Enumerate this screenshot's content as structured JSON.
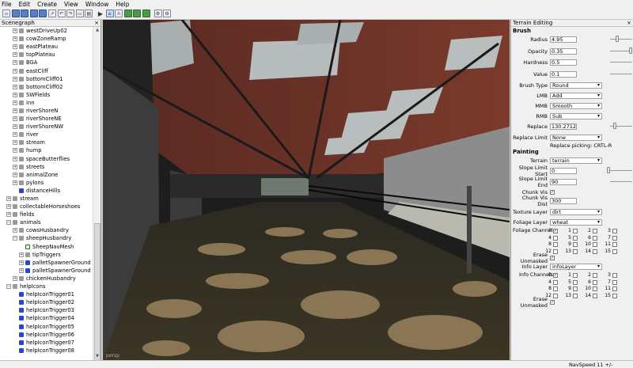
{
  "menu": [
    "File",
    "Edit",
    "Create",
    "View",
    "Window",
    "Help"
  ],
  "toolbar_icons": [
    "new-file",
    "open-file",
    "save-file",
    "save-all",
    "import",
    "export",
    "undo",
    "redo",
    "copy",
    "paste",
    "play",
    "select-tool",
    "terrain-tool",
    "foliage-tool",
    "grass-tool",
    "paint-tool",
    "snap-tool",
    "settings-tool"
  ],
  "scenegraph": {
    "title": "Scenegraph",
    "close": "×",
    "rows": [
      {
        "label": "westDriveUp02",
        "indent": 1,
        "icon": "grp",
        "exp": "+"
      },
      {
        "label": "cowZoneRamp",
        "indent": 1,
        "icon": "grp",
        "exp": "+"
      },
      {
        "label": "eastPlateau",
        "indent": 1,
        "icon": "grp",
        "exp": "+"
      },
      {
        "label": "topPlateau",
        "indent": 1,
        "icon": "grp",
        "exp": "+"
      },
      {
        "label": "BGA",
        "indent": 1,
        "icon": "grp",
        "exp": "+"
      },
      {
        "label": "eastCliff",
        "indent": 1,
        "icon": "grp",
        "exp": "+"
      },
      {
        "label": "bottomCliff01",
        "indent": 1,
        "icon": "grp",
        "exp": "+"
      },
      {
        "label": "bottomCliff02",
        "indent": 1,
        "icon": "grp",
        "exp": "+"
      },
      {
        "label": "SWFields",
        "indent": 1,
        "icon": "grp",
        "exp": "+"
      },
      {
        "label": "inn",
        "indent": 1,
        "icon": "grp",
        "exp": "+"
      },
      {
        "label": "riverShoreN",
        "indent": 1,
        "icon": "grp",
        "exp": "+"
      },
      {
        "label": "riverShoreNE",
        "indent": 1,
        "icon": "grp",
        "exp": "+"
      },
      {
        "label": "riverShoreNW",
        "indent": 1,
        "icon": "grp",
        "exp": "+"
      },
      {
        "label": "river",
        "indent": 1,
        "icon": "grp",
        "exp": "+"
      },
      {
        "label": "stream",
        "indent": 1,
        "icon": "grp",
        "exp": "+"
      },
      {
        "label": "hump",
        "indent": 1,
        "icon": "grp",
        "exp": "+"
      },
      {
        "label": "spaceButterflies",
        "indent": 1,
        "icon": "grp",
        "exp": "+"
      },
      {
        "label": "streets",
        "indent": 1,
        "icon": "grp",
        "exp": "+"
      },
      {
        "label": "animalZone",
        "indent": 1,
        "icon": "grp",
        "exp": "+"
      },
      {
        "label": "pylons",
        "indent": 1,
        "icon": "grp",
        "exp": "+"
      },
      {
        "label": "distanceHills",
        "indent": 1,
        "icon": "blue",
        "exp": ""
      },
      {
        "label": "stream",
        "indent": 0,
        "icon": "grp",
        "exp": "+"
      },
      {
        "label": "collectableHorseshoes",
        "indent": 0,
        "icon": "grp",
        "exp": "+"
      },
      {
        "label": "fields",
        "indent": 0,
        "icon": "grp",
        "exp": "+"
      },
      {
        "label": "animals",
        "indent": 0,
        "icon": "grp",
        "exp": "−"
      },
      {
        "label": "cowsHusbandry",
        "indent": 1,
        "icon": "grp",
        "exp": "+"
      },
      {
        "label": "sheepHusbandry",
        "indent": 1,
        "icon": "grp",
        "exp": "−"
      },
      {
        "label": "SheepNavMesh",
        "indent": 2,
        "icon": "mesh",
        "exp": ""
      },
      {
        "label": "tipTriggers",
        "indent": 2,
        "icon": "grp",
        "exp": "+"
      },
      {
        "label": "palletSpawnerGround",
        "indent": 2,
        "icon": "blue",
        "exp": "+"
      },
      {
        "label": "palletSpawnerGround",
        "indent": 2,
        "icon": "blue",
        "exp": "+"
      },
      {
        "label": "chickenHusbandry",
        "indent": 1,
        "icon": "grp",
        "exp": "+"
      },
      {
        "label": "helpIcons",
        "indent": 0,
        "icon": "grp",
        "exp": "−"
      },
      {
        "label": "helpIconTrigger01",
        "indent": 1,
        "icon": "blue",
        "exp": ""
      },
      {
        "label": "helpIconTrigger02",
        "indent": 1,
        "icon": "blue",
        "exp": ""
      },
      {
        "label": "helpIconTrigger03",
        "indent": 1,
        "icon": "blue",
        "exp": ""
      },
      {
        "label": "helpIconTrigger04",
        "indent": 1,
        "icon": "blue",
        "exp": ""
      },
      {
        "label": "helpIconTrigger05",
        "indent": 1,
        "icon": "blue",
        "exp": ""
      },
      {
        "label": "helpIconTrigger06",
        "indent": 1,
        "icon": "blue",
        "exp": ""
      },
      {
        "label": "helpIconTrigger07",
        "indent": 1,
        "icon": "blue",
        "exp": ""
      },
      {
        "label": "helpIconTrigger08",
        "indent": 1,
        "icon": "blue",
        "exp": ""
      }
    ]
  },
  "viewport": {
    "camera_label": "persp"
  },
  "terrain": {
    "title": "Terrain Editing",
    "close": "×",
    "brush_label": "Brush",
    "radius_label": "Radius",
    "radius": "4.95",
    "opacity_label": "Opacity",
    "opacity": "0.35",
    "hardness_label": "Hardness",
    "hardness": "0.5",
    "value_label": "Value",
    "value": "0.1",
    "brush_type_label": "Brush Type",
    "brush_type": "Round",
    "lmb_label": "LMB",
    "lmb": "Add",
    "mmb_label": "MMB",
    "mmb": "Smooth",
    "rmb_label": "RMB",
    "rmb": "Sub",
    "replace_label": "Replace",
    "replace": "130.27122",
    "replace_limit_label": "Replace Limit",
    "replace_limit": "None",
    "replace_picking": "Replace picking: CRTL-R",
    "painting_label": "Painting",
    "terrain_label": "Terrain",
    "terrain_value": "terrain",
    "slope_start_label": "Slope Limit Start",
    "slope_start": "0",
    "slope_end_label": "Slope Limit End",
    "slope_end": "90",
    "chunk_vis_label": "Chunk Vis",
    "chunk_vis_dist_label": "Chunk Vis Dist",
    "chunk_vis_dist": "300",
    "texture_layer_label": "Texture Layer",
    "texture_layer": "dirt",
    "foliage_layer_label": "Foliage Layer",
    "foliage_layer": "wheat",
    "foliage_channels_label": "Foliage Channels",
    "erase_unmasked_label": "Erase Unmasked",
    "info_layer_label": "Info Layer",
    "info_layer": "infoLayer",
    "info_channels_label": "Info Channels",
    "erase_unmasked2_label": "Erase Unmasked",
    "channel_numbers": [
      "0",
      "1",
      "2",
      "3",
      "4",
      "5",
      "6",
      "7",
      "8",
      "9",
      "10",
      "11",
      "12",
      "13",
      "14",
      "15"
    ],
    "check": "✓"
  },
  "status": {
    "navspeed": "NavSpeed 11 +/-"
  }
}
